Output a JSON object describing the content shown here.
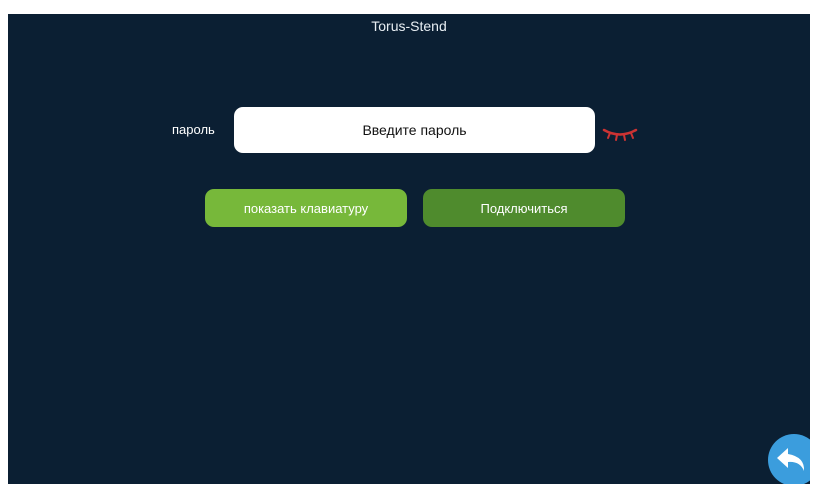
{
  "header": {
    "title": "Torus-Stend"
  },
  "password": {
    "label": "пароль",
    "placeholder": "Введите пароль",
    "toggle_icon": "eye-closed-icon"
  },
  "buttons": {
    "show_keyboard": "показать клавиатуру",
    "connect": "Подключиться"
  },
  "navigation": {
    "back_icon": "back-arrow-icon"
  },
  "colors": {
    "background": "#0b1f33",
    "button_light_green": "#77b83a",
    "button_dark_green": "#4f8b2d",
    "eye_icon": "#cc3333",
    "back_button": "#3b9ddd"
  }
}
